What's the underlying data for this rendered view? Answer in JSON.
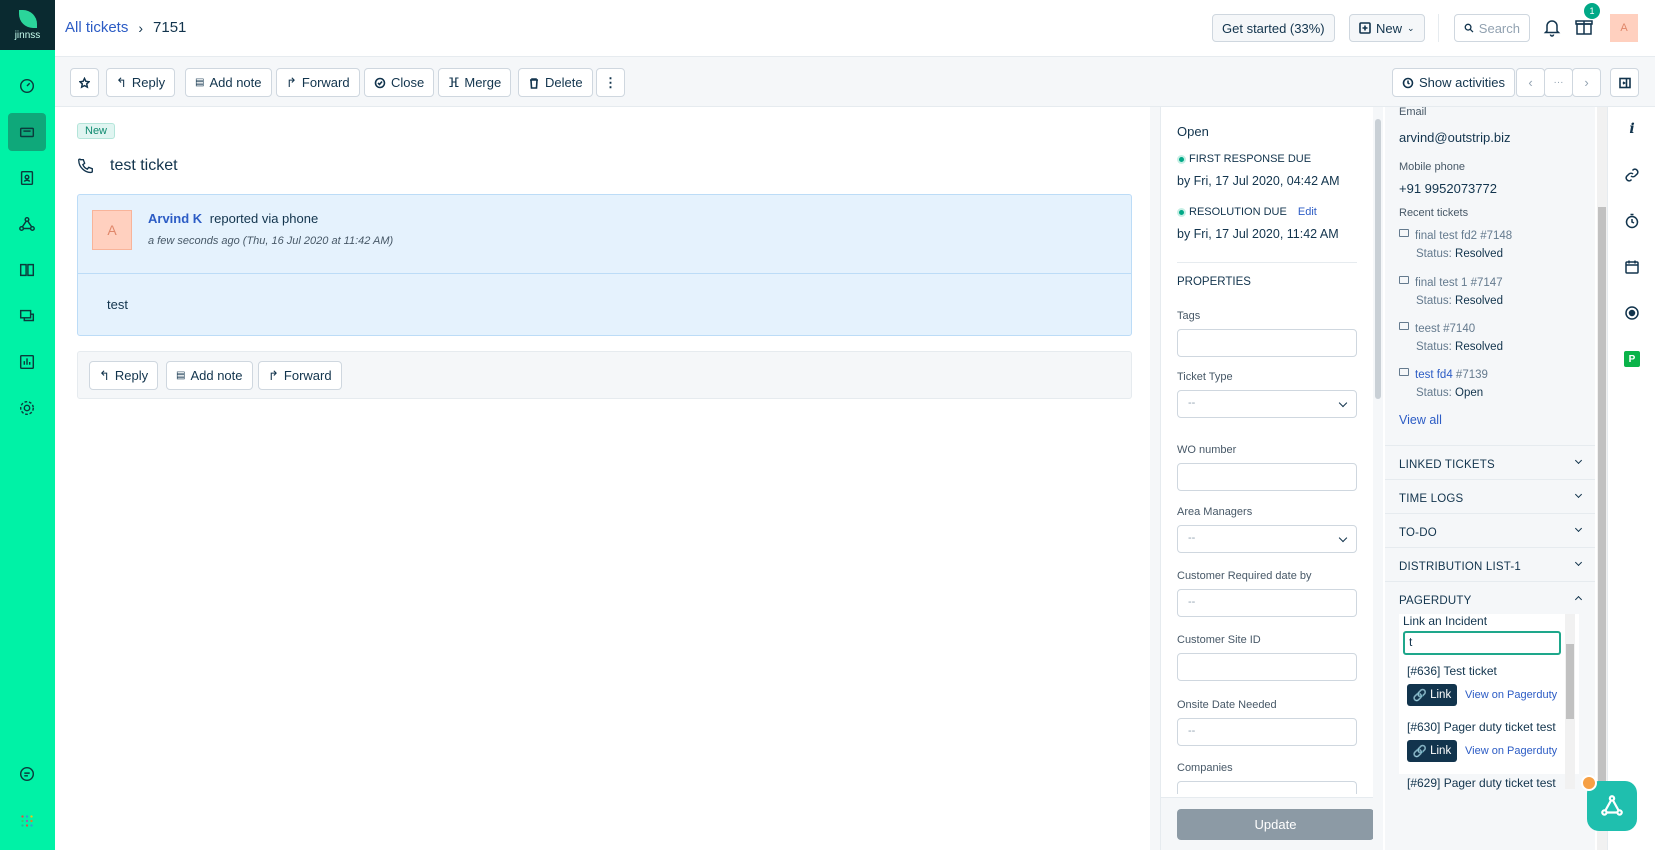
{
  "brand": {
    "name": "jinnss"
  },
  "breadcrumb": {
    "all_tickets": "All tickets",
    "ticket_id": "7151"
  },
  "header": {
    "get_started": "Get started (33%)",
    "new_label": "New",
    "search_placeholder": "Search",
    "gift_badge": "1",
    "avatar_initial": "A"
  },
  "toolbar": {
    "reply": "Reply",
    "add_note": "Add note",
    "forward": "Forward",
    "close": "Close",
    "merge": "Merge",
    "delete": "Delete",
    "show_activities": "Show activities",
    "nav_dots": "···"
  },
  "ticket": {
    "status_badge": "New",
    "subject": "test ticket",
    "reporter_name": "Arvind K",
    "reporter_via": "reported via phone",
    "timestamp": "a few seconds ago (Thu, 16 Jul 2020 at 11:42 AM)",
    "avatar_initial": "A",
    "body": "test"
  },
  "reply_bar": {
    "reply": "Reply",
    "add_note": "Add note",
    "forward": "Forward"
  },
  "properties": {
    "status": "Open",
    "first_response_label": "FIRST RESPONSE DUE",
    "first_response_value": "by Fri, 17 Jul 2020, 04:42 AM",
    "resolution_label": "RESOLUTION DUE",
    "resolution_edit": "Edit",
    "resolution_value": "by Fri, 17 Jul 2020, 11:42 AM",
    "section_title": "PROPERTIES",
    "tags_label": "Tags",
    "ticket_type_label": "Ticket Type",
    "ticket_type_value": "--",
    "wo_number_label": "WO number",
    "area_managers_label": "Area Managers",
    "area_managers_value": "--",
    "customer_required_label": "Customer Required date by",
    "customer_required_placeholder": "--",
    "customer_site_label": "Customer Site ID",
    "onsite_label": "Onsite Date Needed",
    "onsite_placeholder": "--",
    "companies_label": "Companies",
    "update_button": "Update"
  },
  "contact": {
    "email_label": "Email",
    "email_value": "arvind@outstrip.biz",
    "mobile_label": "Mobile phone",
    "mobile_value": "+91 9952073772",
    "recent_label": "Recent tickets",
    "recent_tickets": [
      {
        "title": "final test fd2 #7148",
        "status_label": "Status:",
        "status": "Resolved"
      },
      {
        "title": "final test 1 #7147",
        "status_label": "Status:",
        "status": "Resolved"
      },
      {
        "title": "teest #7140",
        "status_label": "Status:",
        "status": "Resolved"
      },
      {
        "title_link": "test fd4",
        "title_id": "#7139",
        "status_label": "Status:",
        "status": "Open"
      }
    ],
    "view_all": "View all",
    "sections": [
      "LINKED TICKETS",
      "TIME LOGS",
      "TO-DO",
      "DISTRIBUTION LIST-1",
      "PAGERDUTY"
    ]
  },
  "pagerduty": {
    "title": "Link an Incident",
    "input_value": "t",
    "results": [
      {
        "title": "[#636] Test ticket",
        "link": "Link",
        "view": "View on Pagerduty"
      },
      {
        "title": "[#630] Pager duty ticket test",
        "link": "Link",
        "view": "View on Pagerduty"
      },
      {
        "title": "[#629] Pager duty ticket test"
      }
    ]
  },
  "rail": {
    "p_label": "P"
  },
  "colors": {
    "nav_bg": "#00f2a6",
    "accent": "#2c5cc5",
    "dark": "#12344d",
    "pd_green": "#1ea78b"
  }
}
